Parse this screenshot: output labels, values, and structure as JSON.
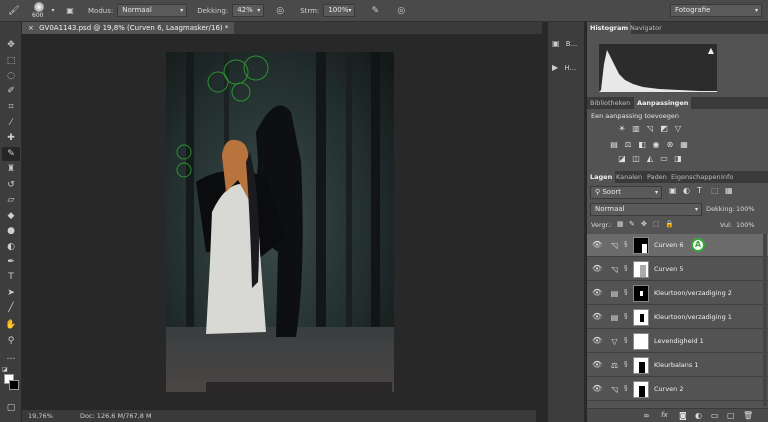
{
  "options_bar": {
    "brush_size": "600",
    "mode_label": "Modus:",
    "mode_value": "Normaal",
    "opacity_label": "Dekking:",
    "opacity_value": "42%",
    "flow_label": "Strm:",
    "flow_value": "100%",
    "workspace": "Fotografie"
  },
  "document": {
    "tab_title": "GV0A1143.psd @ 19,8% (Curven 6, Laagmasker/16) *"
  },
  "status": {
    "zoom": "19,76%",
    "doc_size": "Doc: 126,6 M/767,8 M"
  },
  "dock": {
    "items": [
      {
        "icon": "people-icon",
        "label": "B..."
      },
      {
        "icon": "play-icon",
        "label": "H..."
      }
    ]
  },
  "panels": {
    "top_tabs": [
      "Histogram",
      "Navigator"
    ],
    "mid_tabs": [
      "Bibliotheken",
      "Aanpassingen"
    ],
    "adjust_title": "Een aanpassing toevoegen",
    "layer_tabs": [
      "Lagen",
      "Kanalen",
      "Paden",
      "Eigenschappen",
      "Info"
    ],
    "filter_kind": "Soort",
    "blend_mode": "Normaal",
    "opacity_label": "Dekking:",
    "opacity_value": "100%",
    "lock_label": "Vergr.:",
    "fill_label": "Vul:",
    "fill_value": "100%",
    "badge": "A",
    "layers": [
      {
        "name": "Curven 6",
        "symbol": "curves-icon",
        "mask": "black-figure",
        "selected": true
      },
      {
        "name": "Curven 5",
        "symbol": "curves-icon",
        "mask": "white-gray"
      },
      {
        "name": "Kleurtoon/verzadiging 2",
        "symbol": "hue-sat-icon",
        "mask": "black-small"
      },
      {
        "name": "Kleurtoon/verzadiging 1",
        "symbol": "hue-sat-icon",
        "mask": "white-figure"
      },
      {
        "name": "Levendigheid 1",
        "symbol": "vibrance-icon",
        "mask": "white"
      },
      {
        "name": "Kleurbalans 1",
        "symbol": "color-balance-icon",
        "mask": "white-figure"
      },
      {
        "name": "Curven 2",
        "symbol": "curves-icon",
        "mask": "white-figure"
      }
    ]
  }
}
